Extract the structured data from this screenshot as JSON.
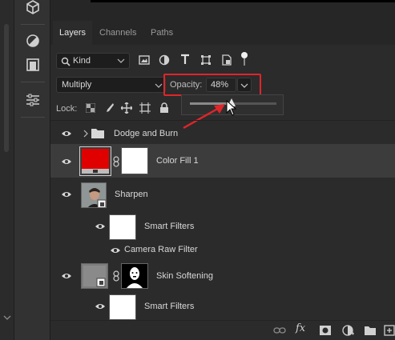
{
  "tabs": [
    {
      "label": "Layers"
    },
    {
      "label": "Channels"
    },
    {
      "label": "Paths"
    }
  ],
  "filter": {
    "kind_label": "Kind"
  },
  "blend": {
    "mode": "Multiply"
  },
  "opacity": {
    "label": "Opacity:",
    "value": "48%",
    "level": 0.48
  },
  "lock": {
    "label": "Lock:"
  },
  "layers": [
    {
      "name": "Dodge and Burn",
      "type": "group"
    },
    {
      "name": "Color Fill 1",
      "type": "fill",
      "selected": true,
      "color": "#e00000"
    },
    {
      "name": "Sharpen",
      "type": "smart-object"
    },
    {
      "name": "Smart Filters",
      "type": "smart-filters"
    },
    {
      "name": "Camera Raw Filter",
      "type": "filter"
    },
    {
      "name": "Skin Softening",
      "type": "smart-object"
    },
    {
      "name": "Smart Filters",
      "type": "smart-filters"
    }
  ],
  "colors": {
    "annotation": "#e0252a",
    "panel_bg": "#2b2b2b",
    "selected_row": "#3c3c3c"
  }
}
